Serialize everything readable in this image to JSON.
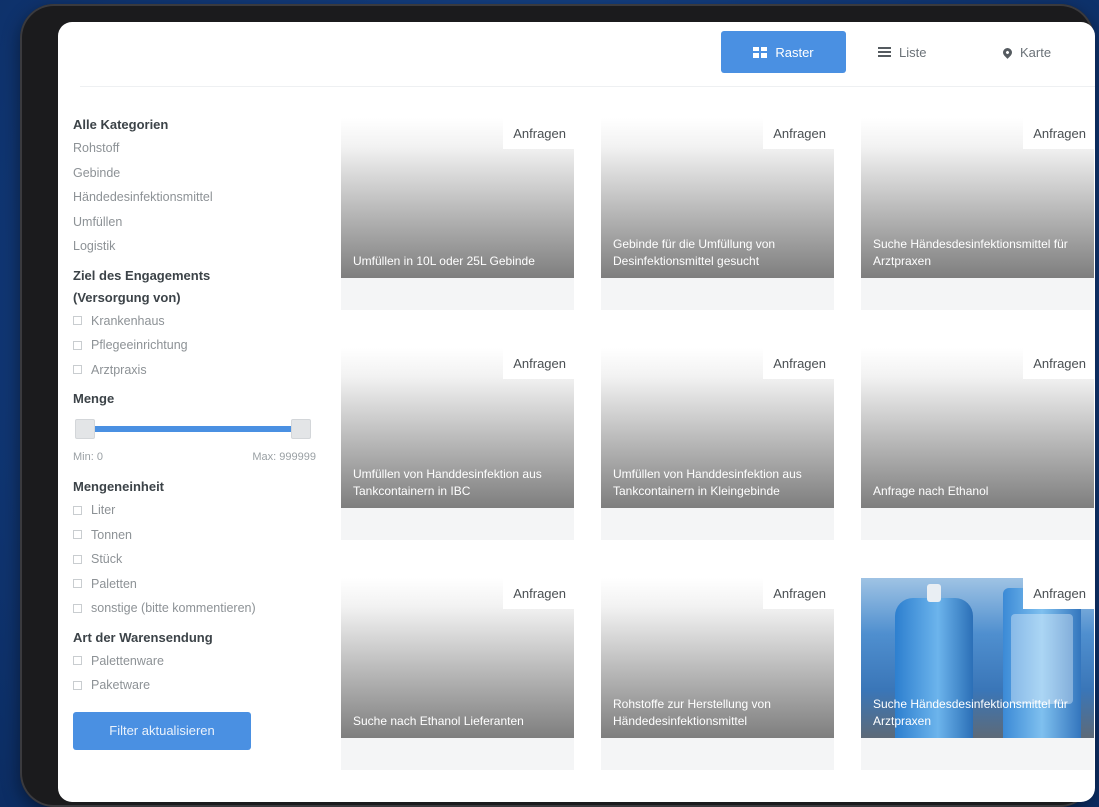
{
  "view_switch": {
    "raster": "Raster",
    "liste": "Liste",
    "karte": "Karte",
    "active": "raster"
  },
  "filters": {
    "categories": {
      "heading": "Alle Kategorien",
      "items": [
        "Rohstoff",
        "Gebinde",
        "Händedesinfektionsmittel",
        "Umfüllen",
        "Logistik"
      ]
    },
    "engagement": {
      "heading_line1": "Ziel des Engagements",
      "heading_line2": "(Versorgung von)",
      "options": [
        "Krankenhaus",
        "Pflegeeinrichtung",
        "Arztpraxis"
      ]
    },
    "menge": {
      "heading": "Menge",
      "min_label": "Min: 0",
      "max_label": "Max: 999999",
      "range_min_fraction": 0.0,
      "range_max_fraction": 1.0
    },
    "mengeneinheit": {
      "heading": "Mengeneinheit",
      "options": [
        "Liter",
        "Tonnen",
        "Stück",
        "Paletten",
        "sonstige (bitte kommentieren)"
      ]
    },
    "warensendung": {
      "heading": "Art der Warensendung",
      "options": [
        "Palettenware",
        "Paketware"
      ]
    },
    "submit": "Filter aktualisieren"
  },
  "cards": [
    {
      "request": "Anfragen",
      "title": "Umfüllen in 10L oder 25L Gebinde"
    },
    {
      "request": "Anfragen",
      "title": "Gebinde für die Umfüllung von Desinfektionsmittel gesucht"
    },
    {
      "request": "Anfragen",
      "title": "Suche Händesdesinfektionsmittel für Arztpraxen"
    },
    {
      "request": "Anfragen",
      "title": "Umfüllen von Handdesinfektion aus Tankcontainern in IBC"
    },
    {
      "request": "Anfragen",
      "title": "Umfüllen von Handdesinfektion aus Tankcontainern in Kleingebinde"
    },
    {
      "request": "Anfragen",
      "title": "Anfrage nach Ethanol"
    },
    {
      "request": "Anfragen",
      "title": "Suche nach Ethanol Lieferanten"
    },
    {
      "request": "Anfragen",
      "title": "Rohstoffe zur Herstellung von Händedesinfektionsmittel"
    },
    {
      "request": "Anfragen",
      "title": "Suche Händesdesinfektionsmittel für Arztpraxen"
    }
  ],
  "colors": {
    "accent": "#4a90e2",
    "background": "#123a7a"
  }
}
